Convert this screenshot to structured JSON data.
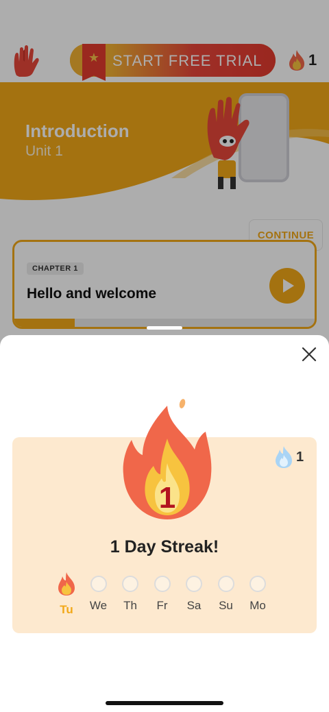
{
  "topbar": {
    "trial_button_label": "START FREE TRIAL",
    "streak_count": "1"
  },
  "hero": {
    "title": "Introduction",
    "subtitle": "Unit 1"
  },
  "chapter": {
    "tag": "CHAPTER 1",
    "title": "Hello and welcome",
    "continue_label": "CONTINUE",
    "progress_fraction": 0.2
  },
  "streak_sheet": {
    "flame_number": "1",
    "freeze_count": "1",
    "title": "1 Day Streak!",
    "days": [
      {
        "label": "Tu",
        "done": true
      },
      {
        "label": "We",
        "done": false
      },
      {
        "label": "Th",
        "done": false
      },
      {
        "label": "Fr",
        "done": false
      },
      {
        "label": "Sa",
        "done": false
      },
      {
        "label": "Su",
        "done": false
      },
      {
        "label": "Mo",
        "done": false
      }
    ]
  },
  "colors": {
    "accent": "#f2a818",
    "trial_red": "#e43a2f",
    "card_bg": "#fde9cf",
    "flame_orange": "#f0674a",
    "flame_yellow": "#f7c33f",
    "number_red": "#b3141f"
  },
  "icons": {
    "logo": "hand-logo-icon",
    "streak": "flame-icon",
    "freeze": "blue-flame-icon",
    "close": "close-icon",
    "play": "play-icon"
  }
}
